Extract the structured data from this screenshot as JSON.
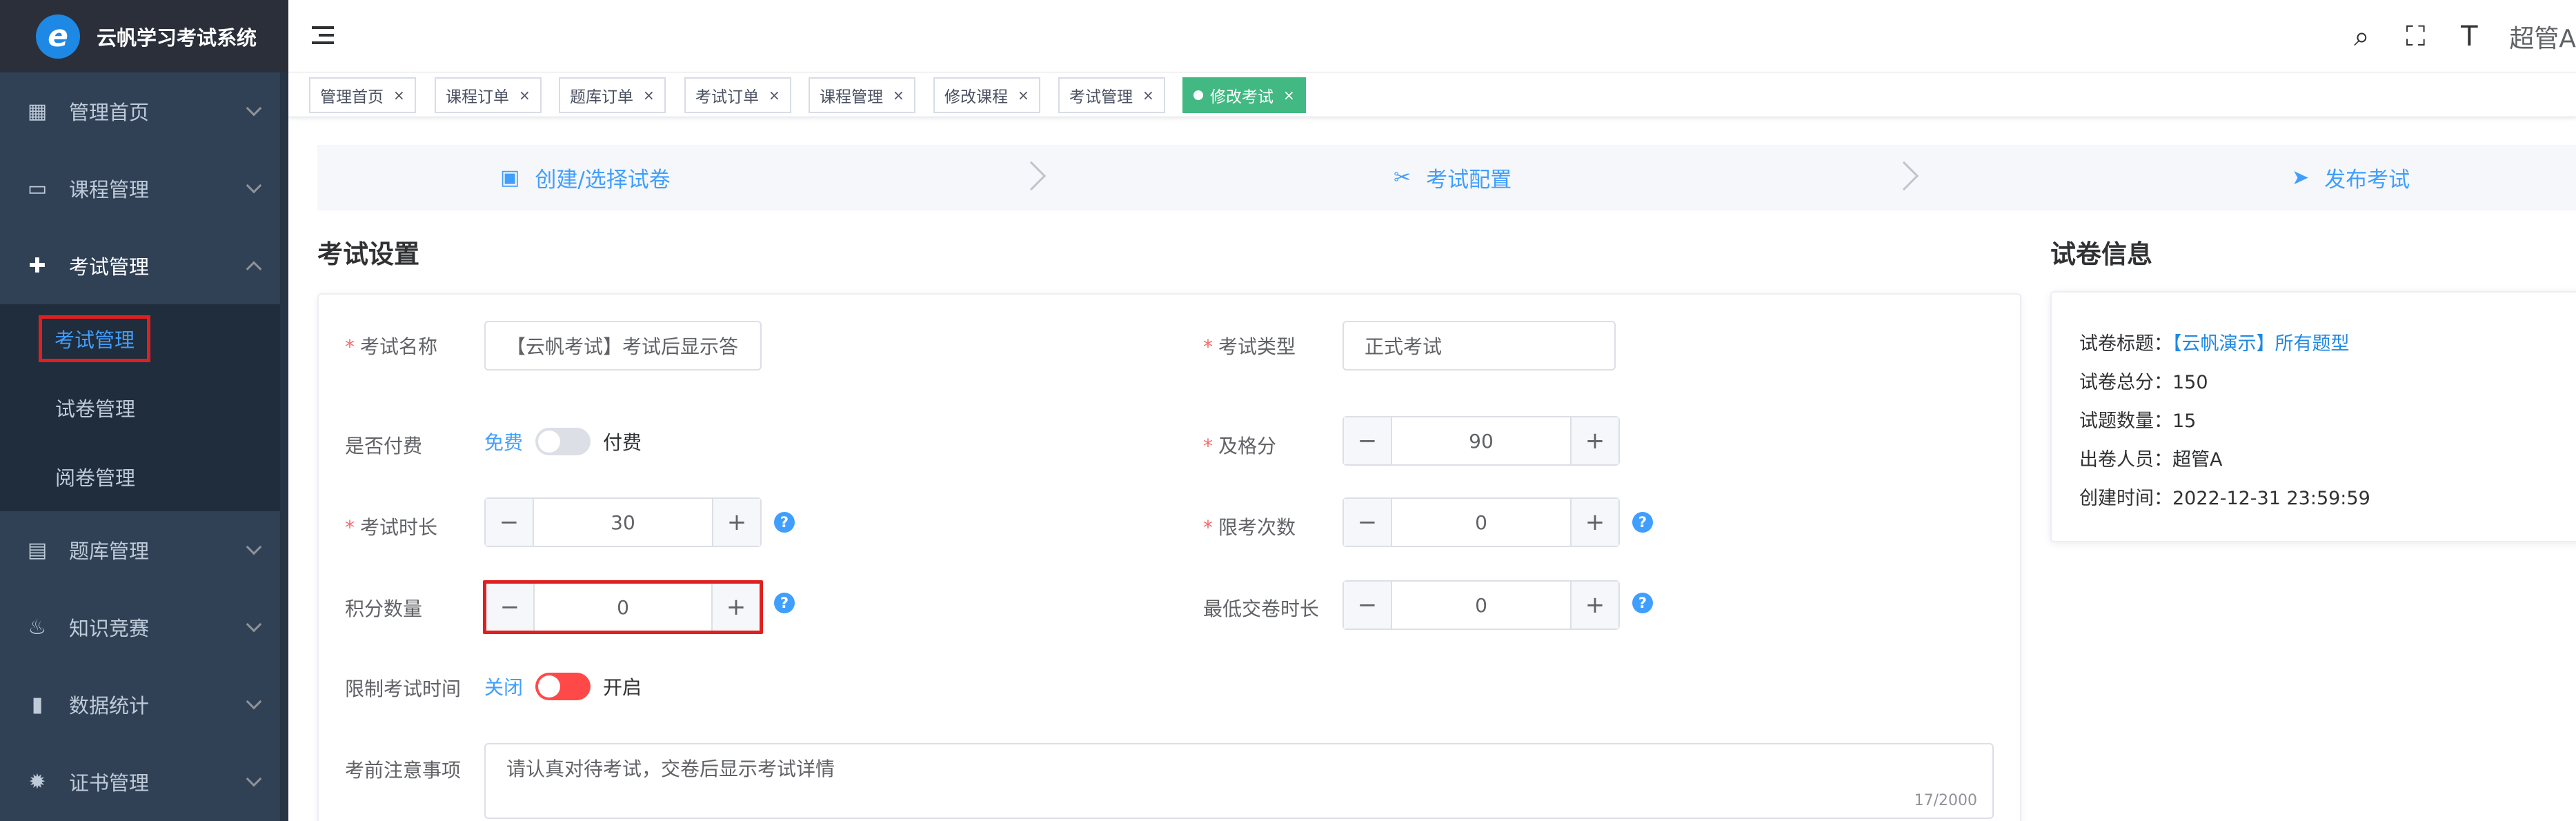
{
  "app": {
    "title": "云帆学习考试系统",
    "logo_glyph": "e"
  },
  "sidebar": {
    "items": [
      {
        "label": "管理首页",
        "icon": "dashboard-icon",
        "glyph": "▦"
      },
      {
        "label": "课程管理",
        "icon": "monitor-icon",
        "glyph": "▭"
      },
      {
        "label": "考试管理",
        "icon": "exam-icon",
        "glyph": "✚"
      },
      {
        "label": "题库管理",
        "icon": "document-icon",
        "glyph": "▤"
      },
      {
        "label": "知识竞赛",
        "icon": "fire-icon",
        "glyph": "♨"
      },
      {
        "label": "数据统计",
        "icon": "bar-chart-icon",
        "glyph": "▮"
      },
      {
        "label": "证书管理",
        "icon": "certificate-icon",
        "glyph": "✹"
      }
    ],
    "exam_sub": [
      "考试管理",
      "试卷管理",
      "阅卷管理"
    ]
  },
  "navbar": {
    "user": "超管A",
    "search_glyph": "⌕",
    "fullscreen_glyph": "⛶",
    "size_glyph": "T"
  },
  "tags": [
    {
      "label": "管理首页",
      "active": false
    },
    {
      "label": "课程订单",
      "active": false
    },
    {
      "label": "题库订单",
      "active": false
    },
    {
      "label": "考试订单",
      "active": false
    },
    {
      "label": "课程管理",
      "active": false
    },
    {
      "label": "修改课程",
      "active": false
    },
    {
      "label": "考试管理",
      "active": false
    },
    {
      "label": "修改考试",
      "active": true
    }
  ],
  "tag_close": "×",
  "steps": [
    {
      "label": "创建/选择试卷",
      "icon": "clipboard-icon",
      "glyph": "▣"
    },
    {
      "label": "考试配置",
      "icon": "ticket-icon",
      "glyph": "✂"
    },
    {
      "label": "发布考试",
      "icon": "send-icon",
      "glyph": "➤"
    }
  ],
  "settings_title": "考试设置",
  "info_title": "试卷信息",
  "form": {
    "exam_name": {
      "label": "考试名称",
      "value": "【云帆考试】考试后显示答"
    },
    "exam_type": {
      "label": "考试类型",
      "value": "正式考试"
    },
    "paid": {
      "label": "是否付费",
      "off": "免费",
      "on": "付费"
    },
    "pass_score": {
      "label": "及格分",
      "value": "90"
    },
    "duration": {
      "label": "考试时长",
      "value": "30"
    },
    "attempts": {
      "label": "限考次数",
      "value": "0"
    },
    "points": {
      "label": "积分数量",
      "value": "0"
    },
    "min_submit": {
      "label": "最低交卷时长",
      "value": "0"
    },
    "limit_time": {
      "label": "限制考试时间",
      "off": "关闭",
      "on": "开启"
    },
    "notice": {
      "label": "考前注意事项",
      "value": "请认真对待考试，交卷后显示考试详情",
      "counter": "17/2000"
    },
    "minus": "−",
    "plus": "+",
    "help": "?"
  },
  "paper_info": {
    "title_label": "试卷标题：",
    "title_value": "【云帆演示】所有题型",
    "total_label": "试卷总分：",
    "total_value": "150",
    "count_label": "试题数量：",
    "count_value": "15",
    "author_label": "出卷人员：",
    "author_value": "超管A",
    "created_label": "创建时间：",
    "created_value": "2022-12-31 23:59:59"
  },
  "colors": {
    "primary": "#409eff",
    "sidebar_bg": "#304156",
    "active_tag": "#42b983",
    "highlight": "#e02020"
  }
}
